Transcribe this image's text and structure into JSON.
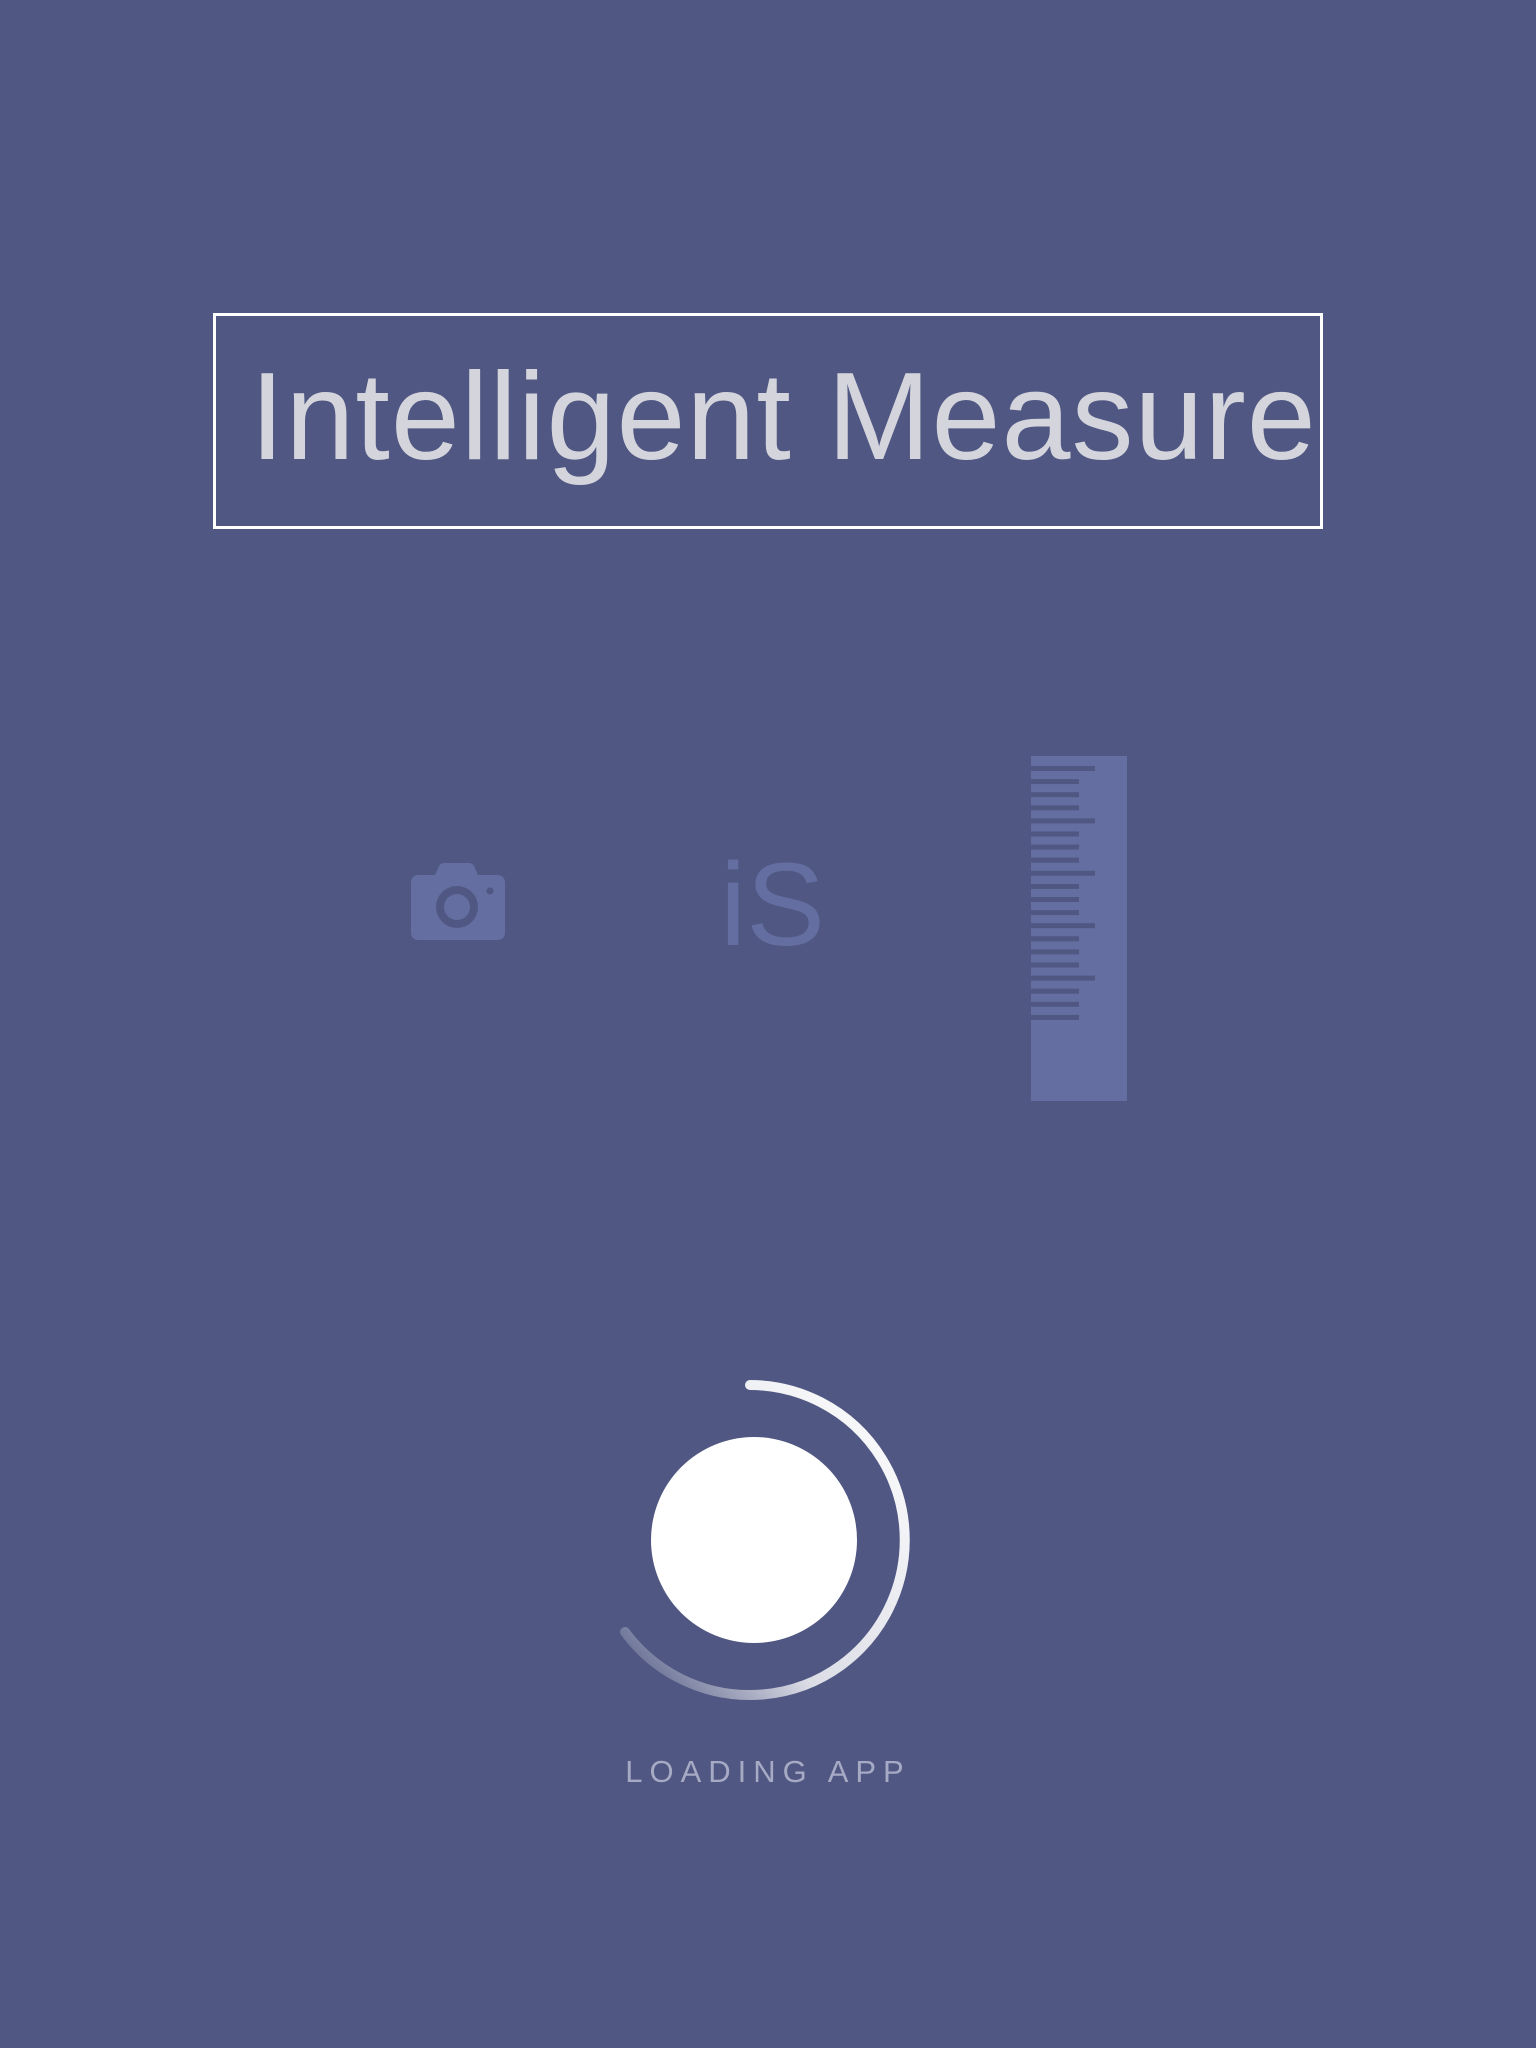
{
  "app": {
    "title": "Intelligent Measure",
    "logo_text": "iS"
  },
  "icons": {
    "camera": "camera-icon",
    "ruler": "ruler-icon",
    "spinner": "loading-spinner"
  },
  "status": {
    "loading_label": "LOADING APP"
  },
  "colors": {
    "background": "#4f5782",
    "title_text": "#d4d4dc",
    "icon_fill": "#656ea0",
    "spinner": "#ffffff"
  }
}
